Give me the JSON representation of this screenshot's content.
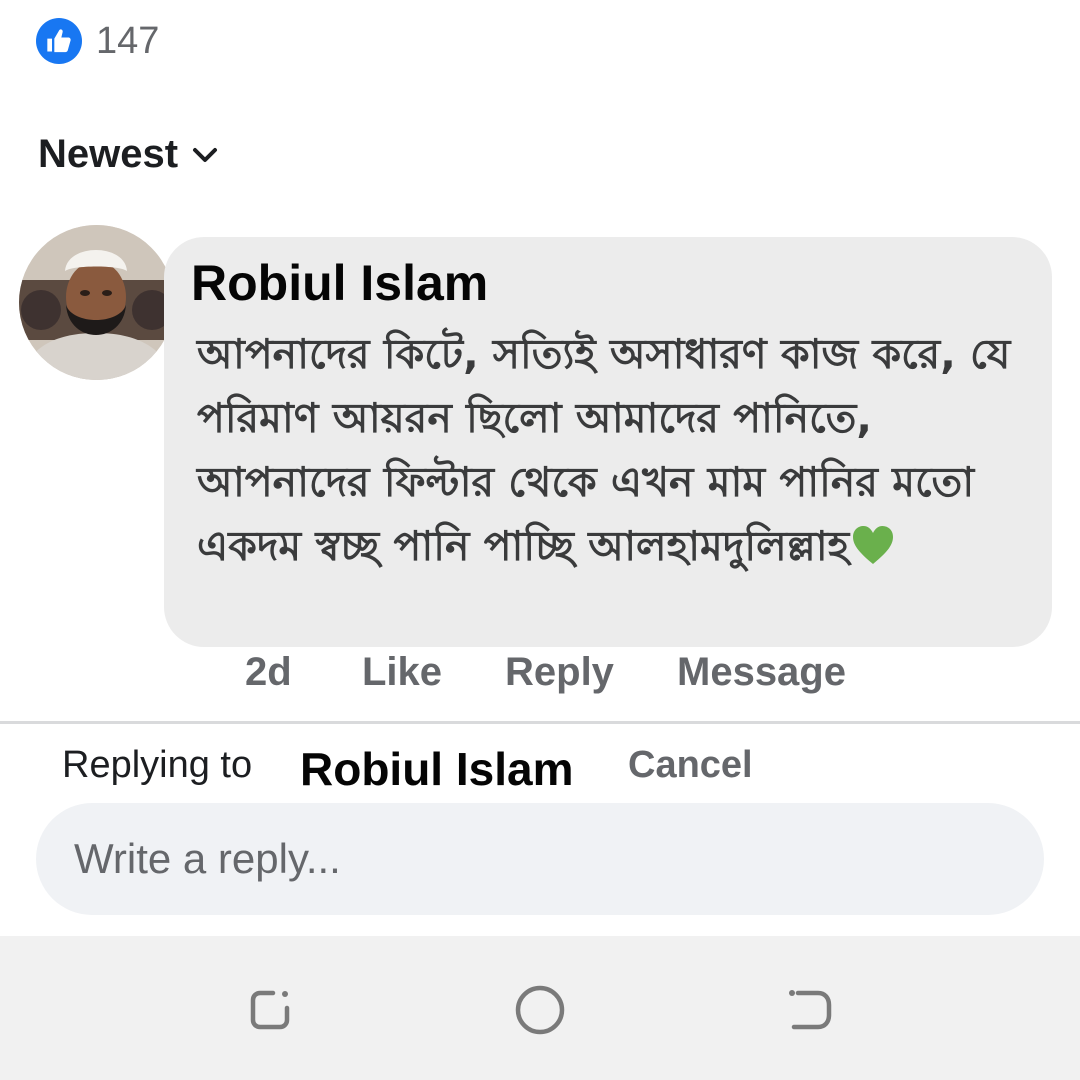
{
  "reactions": {
    "icon": "like-icon",
    "count": "147",
    "color": "#1877f2"
  },
  "sort": {
    "label": "Newest",
    "icon": "chevron-down-icon"
  },
  "comment": {
    "author": "Robiul Islam",
    "text": "আপনাদের কিটে, সত্যিই অসাধারণ কাজ করে, যে পরিমাণ আয়রন ছিলো আমাদের পানিতে, আপনাদের ফিল্টার থেকে এখন মাম পানির মতো একদম স্বচ্ছ পানি পাচ্ছি আলহামদুলিল্লাহ",
    "emoji": "green-heart-icon",
    "time": "2d",
    "actions": {
      "like": "Like",
      "reply": "Reply",
      "message": "Message"
    }
  },
  "reply_bar": {
    "prefix": "Replying to",
    "name": "Robiul Islam",
    "cancel": "Cancel",
    "placeholder": "Write a reply..."
  },
  "nav_bar": {
    "icons": [
      "recents-icon",
      "home-icon",
      "back-icon"
    ]
  }
}
